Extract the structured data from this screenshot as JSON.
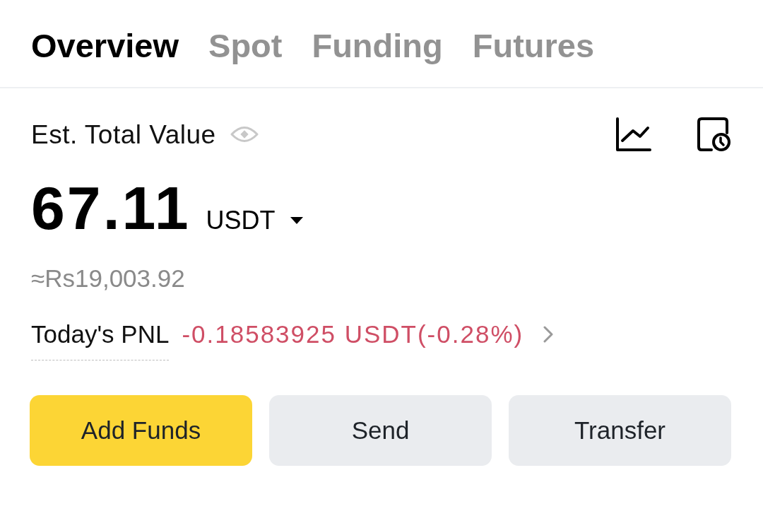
{
  "tabs": [
    {
      "label": "Overview",
      "selected": true
    },
    {
      "label": "Spot",
      "selected": false
    },
    {
      "label": "Funding",
      "selected": false
    },
    {
      "label": "Futures",
      "selected": false
    }
  ],
  "balance": {
    "label": "Est. Total Value",
    "amount": "67.11",
    "currency": "USDT",
    "fiat_equivalent": "≈Rs19,003.92"
  },
  "pnl": {
    "label": "Today's PNL",
    "value": "-0.18583925 USDT(-0.28%)",
    "negative": true
  },
  "actions": [
    {
      "label": "Add Funds",
      "kind": "primary"
    },
    {
      "label": "Send",
      "kind": "secondary"
    },
    {
      "label": "Transfer",
      "kind": "secondary"
    }
  ]
}
